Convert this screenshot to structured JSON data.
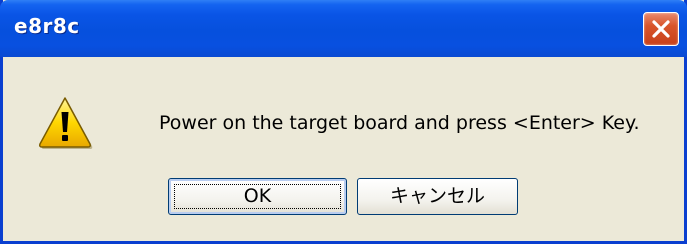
{
  "window": {
    "title": "e8r8c"
  },
  "titlebar": {
    "close_icon": "close-x-icon"
  },
  "dialog": {
    "icon": "warning-icon",
    "message": "Power on the target board and press <Enter> Key."
  },
  "buttons": {
    "ok_label": "OK",
    "cancel_label": "キャンセル"
  },
  "colors": {
    "titlebar": "#0a55e6",
    "close_button": "#d9552b",
    "dialog_background": "#ece9d8",
    "warning_fill": "#ffd700"
  }
}
